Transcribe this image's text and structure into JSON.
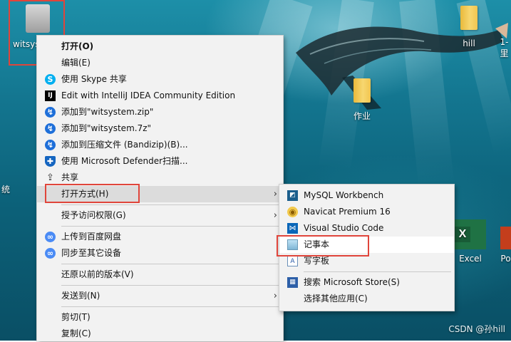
{
  "desktop": {
    "icons": {
      "witsystem": "witsys…",
      "hill": "hill",
      "hill2": "1-里",
      "zuoye": "作业",
      "excel": "Excel",
      "po": "Po",
      "left_label": "统"
    },
    "watermark": "CSDN @孙hill"
  },
  "context_menu": {
    "items": [
      {
        "label": "打开(O)",
        "icon": "none"
      },
      {
        "label": "编辑(E)",
        "icon": "none"
      },
      {
        "label": "使用 Skype 共享",
        "icon": "skype-icon"
      },
      {
        "label": "Edit with IntelliJ IDEA Community Edition",
        "icon": "intellij-icon"
      },
      {
        "label": "添加到\"witsystem.zip\"",
        "icon": "bandizip-icon"
      },
      {
        "label": "添加到\"witsystem.7z\"",
        "icon": "bandizip-icon"
      },
      {
        "label": "添加到压缩文件 (Bandizip)(B)...",
        "icon": "bandizip-icon"
      },
      {
        "label": "使用 Microsoft Defender扫描...",
        "icon": "defender-icon"
      },
      {
        "label": "共享",
        "icon": "share-icon"
      },
      {
        "label": "打开方式(H)",
        "icon": "none"
      },
      {
        "label": "授予访问权限(G)",
        "icon": "none"
      },
      {
        "label": "上传到百度网盘",
        "icon": "baidu-icon"
      },
      {
        "label": "同步至其它设备",
        "icon": "baidu-icon"
      },
      {
        "label": "还原以前的版本(V)",
        "icon": "none"
      },
      {
        "label": "发送到(N)",
        "icon": "none"
      },
      {
        "label": "剪切(T)",
        "icon": "none"
      },
      {
        "label": "复制(C)",
        "icon": "none"
      }
    ]
  },
  "open_with_submenu": {
    "items": [
      {
        "label": "MySQL Workbench",
        "icon": "mysql-icon"
      },
      {
        "label": "Navicat Premium 16",
        "icon": "navicat-icon"
      },
      {
        "label": "Visual Studio Code",
        "icon": "vscode-icon"
      },
      {
        "label": "记事本",
        "icon": "notepad-icon"
      },
      {
        "label": "写字板",
        "icon": "wordpad-icon"
      },
      {
        "label": "搜索 Microsoft Store(S)",
        "icon": "store-icon"
      },
      {
        "label": "选择其他应用(C)",
        "icon": "none"
      }
    ]
  },
  "colors": {
    "highlight_box": "#e0453b",
    "menu_bg": "#f2f2f2",
    "hover_bg": "#dcdcdc"
  }
}
